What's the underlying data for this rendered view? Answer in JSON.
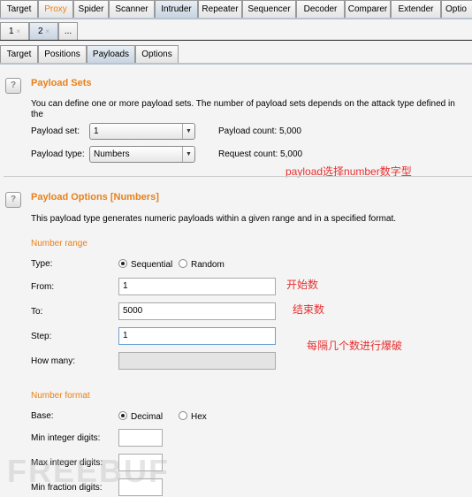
{
  "main_tabs": [
    {
      "label": "Target"
    },
    {
      "label": "Proxy"
    },
    {
      "label": "Spider"
    },
    {
      "label": "Scanner"
    },
    {
      "label": "Intruder"
    },
    {
      "label": "Repeater"
    },
    {
      "label": "Sequencer"
    },
    {
      "label": "Decoder"
    },
    {
      "label": "Comparer"
    },
    {
      "label": "Extender"
    },
    {
      "label": "Optio"
    }
  ],
  "attack_tabs": [
    {
      "label": "1",
      "close": "×"
    },
    {
      "label": "2",
      "close": "×"
    },
    {
      "label": "..."
    }
  ],
  "sub_tabs": [
    {
      "label": "Target"
    },
    {
      "label": "Positions"
    },
    {
      "label": "Payloads"
    },
    {
      "label": "Options"
    }
  ],
  "help_label": "?",
  "payload_sets": {
    "title": "Payload Sets",
    "desc": "You can define one or more payload sets. The number of payload sets depends on the attack type defined in the",
    "set_label": "Payload set:",
    "set_value": "1",
    "type_label": "Payload type:",
    "type_value": "Numbers",
    "payload_count_label": "Payload count:",
    "payload_count": "5,000",
    "request_count_label": "Request count:",
    "request_count": "5,000"
  },
  "payload_options": {
    "title": "Payload Options [Numbers]",
    "desc": "This payload type generates numeric payloads within a given range and in a specified format.",
    "range_heading": "Number range",
    "type_label": "Type:",
    "sequential": "Sequential",
    "random": "Random",
    "from_label": "From:",
    "from_value": "1",
    "to_label": "To:",
    "to_value": "5000",
    "step_label": "Step:",
    "step_value": "1",
    "how_many_label": "How many:",
    "format_heading": "Number format",
    "base_label": "Base:",
    "decimal": "Decimal",
    "hex": "Hex",
    "min_int_label": "Min integer digits:",
    "max_int_label": "Max integer digits:",
    "min_frac_label": "Min fraction digits:"
  },
  "annotations": {
    "type_note": "payload选择number数字型",
    "from_note": "开始数",
    "to_note": "结束数",
    "step_note": "每隔几个数进行爆破"
  },
  "watermark": "FREEBUF",
  "colors": {
    "accent": "#e8801a",
    "annotation": "#e83030"
  }
}
